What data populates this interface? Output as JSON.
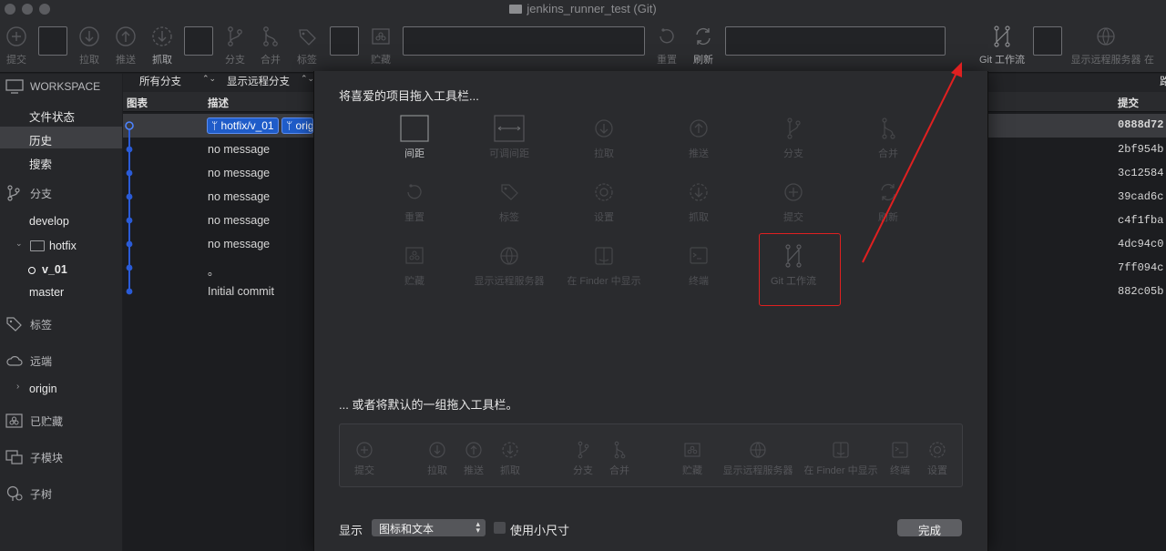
{
  "window": {
    "title": "jenkins_runner_test (Git)"
  },
  "toolbar": {
    "items": [
      {
        "label": "提交",
        "icon": "commit-icon"
      },
      {
        "label": "拉取",
        "icon": "pull-icon"
      },
      {
        "label": "推送",
        "icon": "push-icon"
      },
      {
        "label": "抓取",
        "icon": "fetch-icon"
      },
      {
        "label": "分支",
        "icon": "branch-icon"
      },
      {
        "label": "合并",
        "icon": "merge-icon"
      },
      {
        "label": "标签",
        "icon": "tag-icon"
      },
      {
        "label": "贮藏",
        "icon": "stash-icon"
      },
      {
        "label": "重置",
        "icon": "reset-icon"
      },
      {
        "label": "刷新",
        "icon": "refresh-icon"
      },
      {
        "label": "Git 工作流",
        "icon": "git-flow-icon"
      },
      {
        "label": "显示远程服务器",
        "icon": "globe-icon"
      },
      {
        "label": "在"
      }
    ]
  },
  "sidebar": {
    "workspace": "WORKSPACE",
    "workspace_items": [
      "文件状态",
      "历史",
      "搜索"
    ],
    "selected": "历史",
    "branches_title": "分支",
    "branches": [
      "develop",
      "hotfix",
      "v_01",
      "master"
    ],
    "tags_title": "标签",
    "remotes_title": "远端",
    "remotes": [
      "origin"
    ],
    "stashes_title": "已贮藏",
    "submodules_title": "子模块",
    "subtrees_title": "子树"
  },
  "history": {
    "filter_branches": "所有分支",
    "filter_remote": "显示远程分支",
    "col_graph": "图表",
    "col_desc": "描述",
    "col_commit": "提交",
    "tags": [
      "hotfix/v_01",
      "origin"
    ],
    "rows": [
      {
        "message": "",
        "hash": "0888d72"
      },
      {
        "message": "no message",
        "hash": "2bf954b"
      },
      {
        "message": "no message",
        "hash": "3c12584"
      },
      {
        "message": "no message",
        "hash": "39cad6c"
      },
      {
        "message": "no message",
        "hash": "c4f1fba"
      },
      {
        "message": "no message",
        "hash": "4dc94c0"
      },
      {
        "message": "。",
        "hash": "7ff094c"
      },
      {
        "message": "Initial commit",
        "hash": "882c05b"
      }
    ]
  },
  "dialog": {
    "heading": "将喜爱的项目拖入工具栏...",
    "palette": [
      {
        "label": "间距",
        "icon": "space-icon",
        "state": "enabled"
      },
      {
        "label": "可调间距",
        "icon": "flexible-space-icon",
        "state": "disabled"
      },
      {
        "label": "拉取",
        "icon": "pull-icon",
        "state": "disabled"
      },
      {
        "label": "推送",
        "icon": "push-icon",
        "state": "disabled"
      },
      {
        "label": "分支",
        "icon": "branch-icon",
        "state": "disabled"
      },
      {
        "label": "合并",
        "icon": "merge-icon",
        "state": "disabled"
      },
      {
        "label": "重置",
        "icon": "reset-icon",
        "state": "disabled"
      },
      {
        "label": "标签",
        "icon": "tag-icon",
        "state": "disabled"
      },
      {
        "label": "设置",
        "icon": "gear-icon",
        "state": "disabled"
      },
      {
        "label": "抓取",
        "icon": "fetch-icon",
        "state": "disabled"
      },
      {
        "label": "提交",
        "icon": "commit-icon",
        "state": "disabled"
      },
      {
        "label": "刷新",
        "icon": "refresh-icon",
        "state": "disabled"
      },
      {
        "label": "贮藏",
        "icon": "stash-icon",
        "state": "disabled"
      },
      {
        "label": "显示远程服务器",
        "icon": "globe-icon",
        "state": "disabled"
      },
      {
        "label": "在 Finder 中显示",
        "icon": "finder-icon",
        "state": "disabled"
      },
      {
        "label": "终端",
        "icon": "terminal-icon",
        "state": "disabled"
      },
      {
        "label": "Git 工作流",
        "icon": "git-flow-icon",
        "state": "enabled"
      }
    ],
    "default_heading": "... 或者将默认的一组拖入工具栏。",
    "default_set": [
      "提交",
      "拉取",
      "推送",
      "抓取",
      "分支",
      "合并",
      "贮藏",
      "显示远程服务器",
      "在 Finder 中显示",
      "终端",
      "设置"
    ],
    "show_label": "显示",
    "show_value": "图标和文本",
    "small_size_label": "使用小尺寸",
    "done_label": "完成"
  },
  "colors": {
    "accent": "#1f5cc9",
    "highlight": "#e02020",
    "graph": "#2a5bd7"
  }
}
